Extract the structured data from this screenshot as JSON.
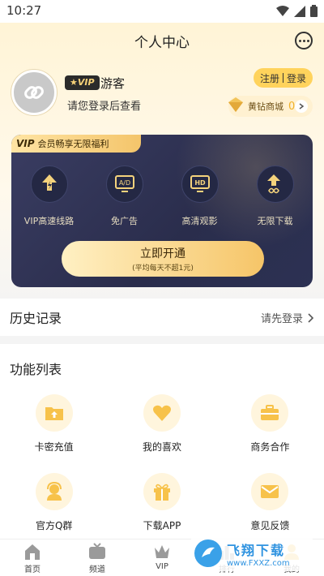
{
  "status_bar": {
    "time": "10:27"
  },
  "header": {
    "title": "个人中心"
  },
  "profile": {
    "vip_tag": "VIP",
    "username": "游客",
    "login_hint": "请您登录后查看",
    "register_label": "注册",
    "login_label": "登录",
    "shop_label": "黄钻商城",
    "shop_count": "0"
  },
  "vip_card": {
    "banner_vip": "VIP",
    "banner_text": "会员畅享无限福利",
    "benefits": [
      {
        "label": "VIP高速线路",
        "icon": "lightning-download-icon"
      },
      {
        "label": "免广告",
        "icon": "ad-block-icon"
      },
      {
        "label": "高清观影",
        "icon": "hd-icon"
      },
      {
        "label": "无限下载",
        "icon": "infinite-download-icon"
      }
    ],
    "open_label": "立即开通",
    "open_sub": "(平均每天不超1元)"
  },
  "history": {
    "title": "历史记录",
    "link": "请先登录"
  },
  "features": {
    "title": "功能列表",
    "items": [
      {
        "label": "卡密充值",
        "icon": "card-recharge-icon"
      },
      {
        "label": "我的喜欢",
        "icon": "heart-icon"
      },
      {
        "label": "商务合作",
        "icon": "briefcase-icon"
      },
      {
        "label": "官方Q群",
        "icon": "support-agent-icon"
      },
      {
        "label": "下载APP",
        "icon": "gift-box-icon"
      },
      {
        "label": "意见反馈",
        "icon": "mail-icon"
      }
    ]
  },
  "tabbar": {
    "items": [
      {
        "label": "首页",
        "icon": "home-icon"
      },
      {
        "label": "频道",
        "icon": "tv-icon"
      },
      {
        "label": "VIP",
        "icon": "crown-icon"
      },
      {
        "label": "排行",
        "icon": "rank-icon"
      },
      {
        "label": "我的",
        "icon": "user-icon"
      }
    ]
  },
  "watermark": {
    "title": "飞翔下载",
    "url": "www.FXXZ.com"
  },
  "colors": {
    "accent": "#ffd35c",
    "vip_dark": "#2e3152",
    "gold": "#f6c568"
  }
}
